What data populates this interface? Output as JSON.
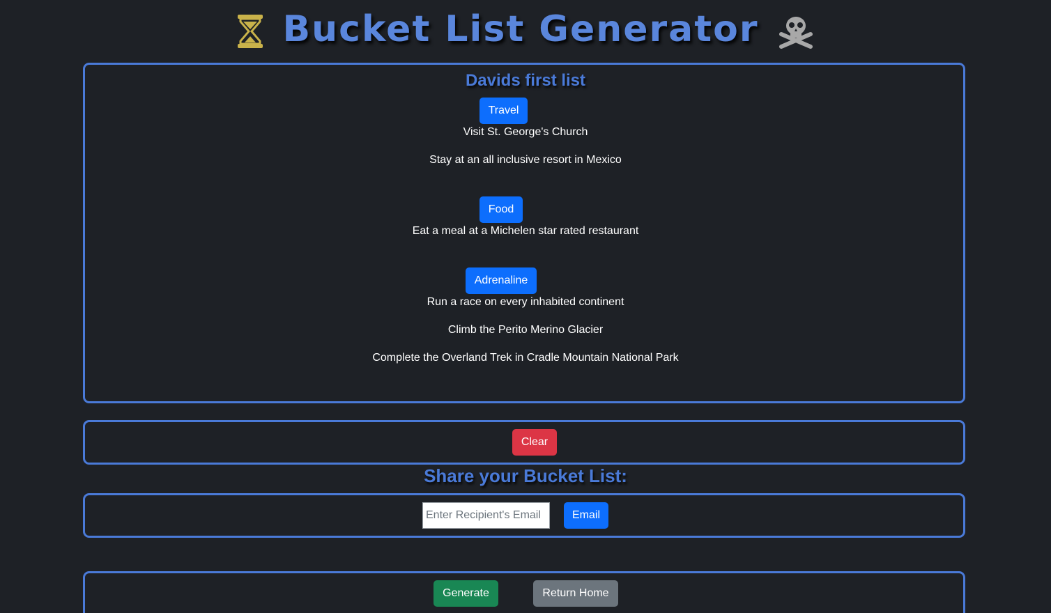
{
  "header": {
    "title": "Bucket List Generator",
    "left_icon": "hourglass-icon",
    "right_icon": "skull-crossbones-icon"
  },
  "list": {
    "title": "Davids first list",
    "categories": [
      {
        "label": "Travel",
        "items": [
          "Visit St. George's Church",
          "Stay at an all inclusive resort in Mexico"
        ]
      },
      {
        "label": "Food",
        "items": [
          "Eat a meal at a Michelen star rated restaurant"
        ]
      },
      {
        "label": "Adrenaline",
        "items": [
          "Run a race on every inhabited continent",
          "Climb the Perito Merino Glacier",
          "Complete the Overland Trek in Cradle Mountain National Park"
        ]
      }
    ]
  },
  "clear": {
    "label": "Clear"
  },
  "share": {
    "heading": "Share your Bucket List:",
    "email_placeholder": "Enter Recipient's Email",
    "email_value": "",
    "email_button": "Email"
  },
  "actions": {
    "generate": "Generate",
    "return_home": "Return Home"
  },
  "colors": {
    "background": "#1e2126",
    "accent": "#4a7ad8",
    "primary": "#0d6efd",
    "danger": "#dc3545",
    "success": "#198754",
    "secondary": "#6c757d",
    "hourglass": "#c9b24a",
    "skull": "#a8a8a8"
  }
}
